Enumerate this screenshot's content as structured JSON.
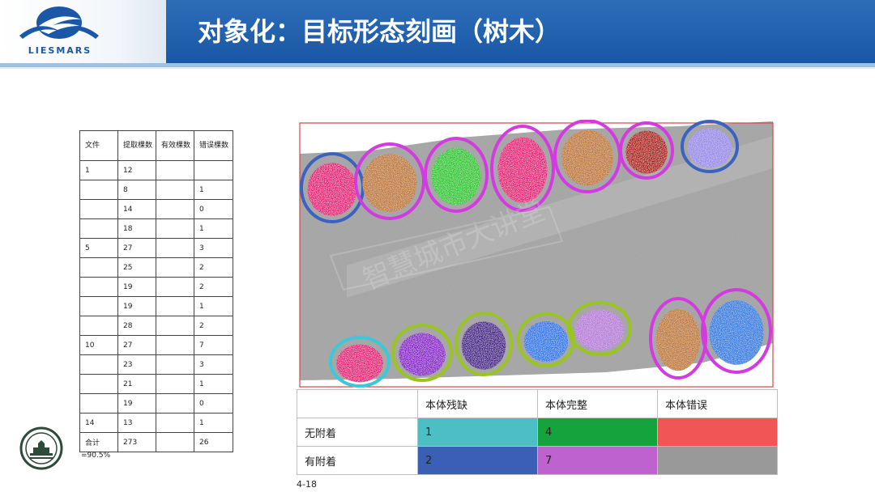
{
  "header": {
    "title": "对象化：目标形态刻画（树木）",
    "logo_text": "LIESMARS",
    "colors": {
      "bar": "#1a57a6",
      "accent": "#9ec2e6"
    }
  },
  "stats_table": {
    "headers": [
      "文件",
      "提取棵数",
      "有效棵数",
      "错误棵数"
    ],
    "rows": [
      [
        "1",
        "12",
        "",
        ""
      ],
      [
        "",
        "8",
        "",
        "1"
      ],
      [
        "",
        "14",
        "",
        "0"
      ],
      [
        "",
        "18",
        "",
        "1"
      ],
      [
        "5",
        "27",
        "",
        "3"
      ],
      [
        "",
        "25",
        "",
        "2"
      ],
      [
        "",
        "19",
        "",
        "2"
      ],
      [
        "",
        "19",
        "",
        "1"
      ],
      [
        "",
        "28",
        "",
        "2"
      ],
      [
        "10",
        "27",
        "",
        "7"
      ],
      [
        "",
        "23",
        "",
        "3"
      ],
      [
        "",
        "21",
        "",
        "1"
      ],
      [
        "",
        "19",
        "",
        "0"
      ],
      [
        "14",
        "13",
        "",
        "1"
      ],
      [
        "合计",
        "273",
        "",
        "26"
      ]
    ],
    "accuracy": "=90.5%"
  },
  "scene": {
    "watermark": "智慧城市大讲堂",
    "top_row_trees": [
      {
        "fill": "#e8197c",
        "ring": "#3a62c0"
      },
      {
        "fill": "#c07a35",
        "ring": "#d33be0"
      },
      {
        "fill": "#29c92c",
        "ring": "#d33be0"
      },
      {
        "fill": "#e8197c",
        "ring": "#d33be0"
      },
      {
        "fill": "#c07a35",
        "ring": "#d33be0"
      },
      {
        "fill": "#b0140e",
        "ring": "#d33be0"
      },
      {
        "fill": "#9a8ce8",
        "ring": "#3a62c0"
      }
    ],
    "bottom_row_trees": [
      {
        "fill": "#e8197c",
        "ring": "#3bc9d9"
      },
      {
        "fill": "#8d1ccc",
        "ring": "#9ac521"
      },
      {
        "fill": "#4a1a8c",
        "ring": "#9ac521"
      },
      {
        "fill": "#2a79e8",
        "ring": "#9ac521"
      },
      {
        "fill": "#b77dd9",
        "ring": "#9ac521"
      },
      {
        "fill": "#c07a35",
        "ring": "#d33be0"
      },
      {
        "fill": "#2f7fe0",
        "ring": "#d33be0"
      }
    ]
  },
  "legend": {
    "col_headers": [
      "",
      "本体残缺",
      "本体完整",
      "本体错误"
    ],
    "rows": [
      {
        "label": "无附着",
        "cells": [
          "1",
          "4",
          ""
        ],
        "colors": [
          "#4bbfc4",
          "#14a33d",
          "#f25555"
        ]
      },
      {
        "label": "有附着",
        "cells": [
          "2",
          "7",
          ""
        ],
        "colors": [
          "#3b5fb5",
          "#be62d0",
          "#999999"
        ]
      }
    ]
  },
  "caption": "4-18"
}
